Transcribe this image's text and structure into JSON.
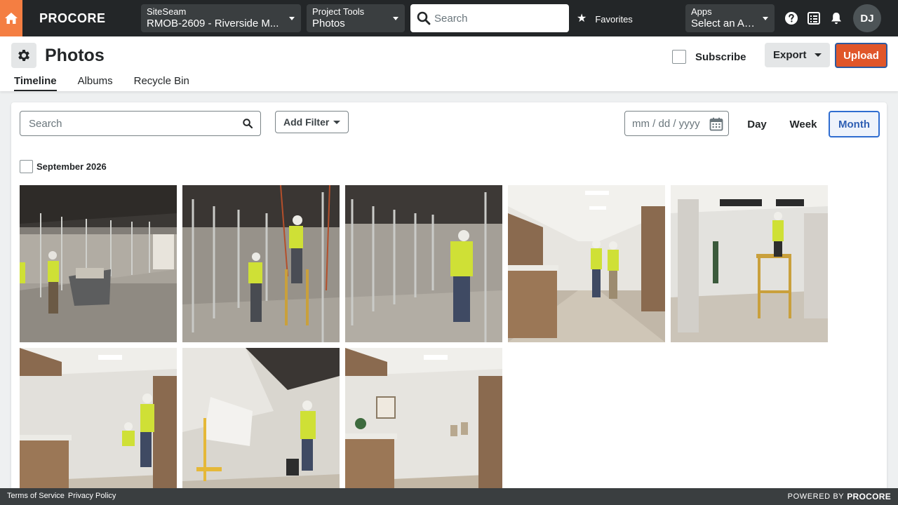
{
  "nav": {
    "logo": "PROCORE",
    "project": {
      "label": "SiteSeam",
      "value": "RMOB-2609 - Riverside M..."
    },
    "tool": {
      "label": "Project Tools",
      "value": "Photos"
    },
    "search_placeholder": "Search",
    "favorites": "Favorites",
    "apps": {
      "label": "Apps",
      "value": "Select an App"
    },
    "avatar_initials": "DJ"
  },
  "header": {
    "title": "Photos",
    "subscribe_label": "Subscribe",
    "export_label": "Export",
    "upload_label": "Upload",
    "tabs": [
      "Timeline",
      "Albums",
      "Recycle Bin"
    ],
    "active_tab": "Timeline"
  },
  "toolbar": {
    "search_placeholder": "Search",
    "add_filter_label": "Add Filter",
    "date_placeholder": "mm / dd / yyyy",
    "views": [
      "Day",
      "Week",
      "Month"
    ],
    "active_view": "Month"
  },
  "timeline": {
    "group_label": "September 2026",
    "photo_count_shown": 8
  },
  "footer": {
    "terms": "Terms of Service",
    "privacy": "Privacy Policy",
    "powered_by": "POWERED BY",
    "powered_brand": "PROCORE"
  },
  "colors": {
    "nav_bg": "#232628",
    "home_accent": "#f47e42",
    "upload_button": "#e0562a",
    "active_view_border": "#2f6dd0"
  }
}
